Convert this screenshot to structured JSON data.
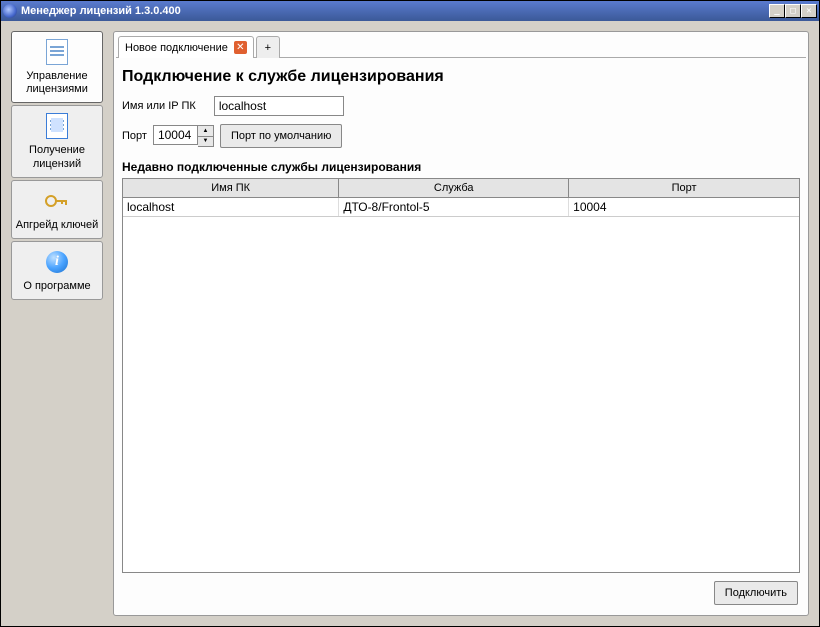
{
  "window": {
    "title": "Менеджер лицензий 1.3.0.400"
  },
  "sidebar": {
    "items": [
      {
        "label": "Управление лицензиями"
      },
      {
        "label": "Получение лицензий"
      },
      {
        "label": "Апгрейд ключей"
      },
      {
        "label": "О программе"
      }
    ]
  },
  "tabs": {
    "active_label": "Новое подключение",
    "add_label": "+"
  },
  "main": {
    "heading": "Подключение к службе лицензирования",
    "host_label": "Имя или IP ПК",
    "host_value": "localhost",
    "port_label": "Порт",
    "port_value": "10004",
    "default_port_btn": "Порт по умолчанию",
    "recent_label": "Недавно подключенные службы лицензирования",
    "columns": {
      "pc": "Имя ПК",
      "service": "Служба",
      "port": "Порт"
    },
    "rows": [
      {
        "pc": "localhost",
        "service": "ДТО-8/Frontol-5",
        "port": "10004"
      }
    ],
    "connect_btn": "Подключить"
  },
  "info_glyph": "i"
}
